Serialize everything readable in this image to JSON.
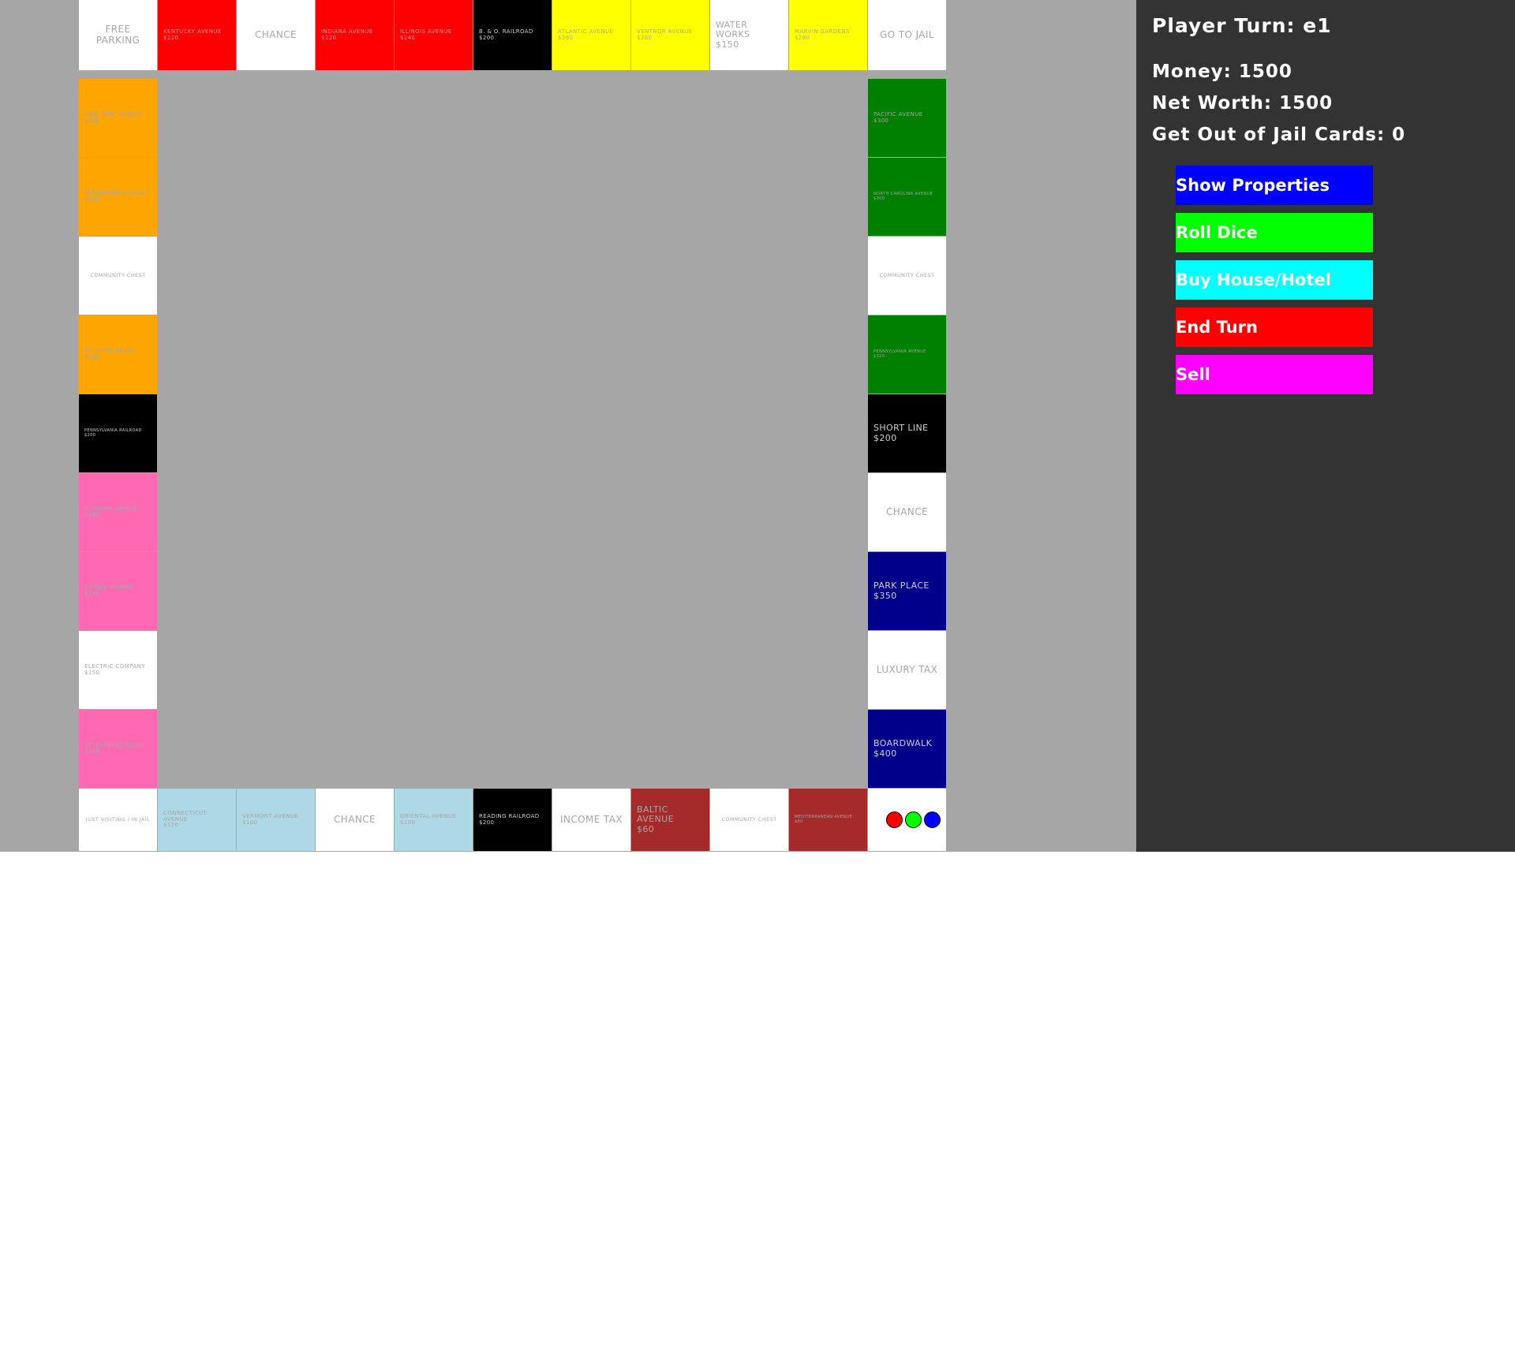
{
  "status": {
    "player_turn": "Player Turn: e1",
    "money": "Money: 1500",
    "net_worth": "Net Worth: 1500",
    "jail_cards": "Get Out of Jail Cards: 0"
  },
  "buttons": {
    "show_properties": {
      "label": "Show Properties",
      "color": "#0000ff"
    },
    "roll_dice": {
      "label": "Roll Dice",
      "color": "#00ff00"
    },
    "buy_house": {
      "label": "Buy House/Hotel",
      "color": "#00ffff"
    },
    "end_turn": {
      "label": "End Turn",
      "color": "#ff0000"
    },
    "sell": {
      "label": "Sell",
      "color": "#ff00ff"
    }
  },
  "colors": {
    "background": "#a6a6a6",
    "panel": "#333333",
    "white_space": "#ffffff",
    "railroad": "#000000",
    "red": "#ff0000",
    "yellow": "#ffff00",
    "orange": "#ffa500",
    "pink": "#ff69b4",
    "light_blue": "#add8e6",
    "brown": "#a52a2a",
    "green": "#008000",
    "dark_blue": "#00008b"
  },
  "tokens": [
    "#ff0000",
    "#00ff00",
    "#0000ff"
  ],
  "board": {
    "top": [
      {
        "name": "free-parking",
        "label": "Free Parking",
        "color": "#ffffff"
      },
      {
        "name": "kentucky-avenue",
        "label": "Kentucky Avenue\n$220",
        "color": "#ff0000"
      },
      {
        "name": "chance-top",
        "label": "Chance",
        "color": "#ffffff"
      },
      {
        "name": "indiana-avenue",
        "label": "Indiana Avenue\n$220",
        "color": "#ff0000"
      },
      {
        "name": "illinois-avenue",
        "label": "Illinois Avenue\n$240",
        "color": "#ff0000"
      },
      {
        "name": "b-and-o-railroad",
        "label": "B. & O. Railroad\n$200",
        "color": "#000000"
      },
      {
        "name": "atlantic-avenue",
        "label": "Atlantic Avenue\n$260",
        "color": "#ffff00"
      },
      {
        "name": "ventnor-avenue",
        "label": "Ventnor Avenue\n$260",
        "color": "#ffff00"
      },
      {
        "name": "water-works",
        "label": "Water Works\n$150",
        "color": "#ffffff"
      },
      {
        "name": "marvin-gardens",
        "label": "Marvin Gardens\n$280",
        "color": "#ffff00"
      },
      {
        "name": "go-to-jail",
        "label": "Go to Jail",
        "color": "#ffffff"
      }
    ],
    "left": [
      {
        "name": "new-york-avenue",
        "label": "New York Avenue\n$200",
        "color": "#ffa500"
      },
      {
        "name": "tennessee-avenue",
        "label": "Tennessee Avenue\n$180",
        "color": "#ffa500"
      },
      {
        "name": "community-chest-left",
        "label": "Community Chest",
        "color": "#ffffff"
      },
      {
        "name": "st-james-place",
        "label": "St. James Place\n$180",
        "color": "#ffa500"
      },
      {
        "name": "pennsylvania-railroad",
        "label": "Pennsylvania Railroad\n$200",
        "color": "#000000"
      },
      {
        "name": "virginia-avenue",
        "label": "Virginia Avenue\n$160",
        "color": "#ff69b4"
      },
      {
        "name": "states-avenue",
        "label": "States Avenue\n$140",
        "color": "#ff69b4"
      },
      {
        "name": "electric-company",
        "label": "Electric Company\n$150",
        "color": "#ffffff"
      },
      {
        "name": "st-charles-place",
        "label": "St. Charles Place\n$140",
        "color": "#ff69b4"
      }
    ],
    "right": [
      {
        "name": "pacific-avenue",
        "label": "Pacific Avenue\n$300",
        "color": "#008000"
      },
      {
        "name": "north-carolina-avenue",
        "label": "North Carolina Avenue\n$300",
        "color": "#008000"
      },
      {
        "name": "community-chest-right",
        "label": "Community Chest",
        "color": "#ffffff"
      },
      {
        "name": "pennsylvania-avenue",
        "label": "Pennsylvania Avenue\n$320",
        "color": "#008000"
      },
      {
        "name": "short-line",
        "label": "Short Line\n$200",
        "color": "#000000"
      },
      {
        "name": "chance-right",
        "label": "Chance",
        "color": "#ffffff"
      },
      {
        "name": "park-place",
        "label": "Park Place\n$350",
        "color": "#00008b"
      },
      {
        "name": "luxury-tax",
        "label": "Luxury Tax",
        "color": "#ffffff"
      },
      {
        "name": "boardwalk",
        "label": "Boardwalk\n$400",
        "color": "#00008b"
      }
    ],
    "bottom": [
      {
        "name": "just-visiting",
        "label": "Just Visiting / In Jail",
        "color": "#ffffff"
      },
      {
        "name": "connecticut-avenue",
        "label": "Connecticut Avenue\n$120",
        "color": "#add8e6"
      },
      {
        "name": "vermont-avenue",
        "label": "Vermont Avenue\n$100",
        "color": "#add8e6"
      },
      {
        "name": "chance-bottom",
        "label": "Chance",
        "color": "#ffffff"
      },
      {
        "name": "oriental-avenue",
        "label": "Oriental Avenue\n$100",
        "color": "#add8e6"
      },
      {
        "name": "reading-railroad",
        "label": "Reading Railroad\n$200",
        "color": "#000000"
      },
      {
        "name": "income-tax",
        "label": "Income Tax",
        "color": "#ffffff"
      },
      {
        "name": "baltic-avenue",
        "label": "Baltic Avenue\n$60",
        "color": "#a52a2a"
      },
      {
        "name": "community-chest-bottom",
        "label": "Community Chest",
        "color": "#ffffff"
      },
      {
        "name": "mediterranean-avenue",
        "label": "Mediterranean Avenue\n$60",
        "color": "#a52a2a"
      },
      {
        "name": "go",
        "label": "",
        "color": "#ffffff"
      }
    ]
  }
}
